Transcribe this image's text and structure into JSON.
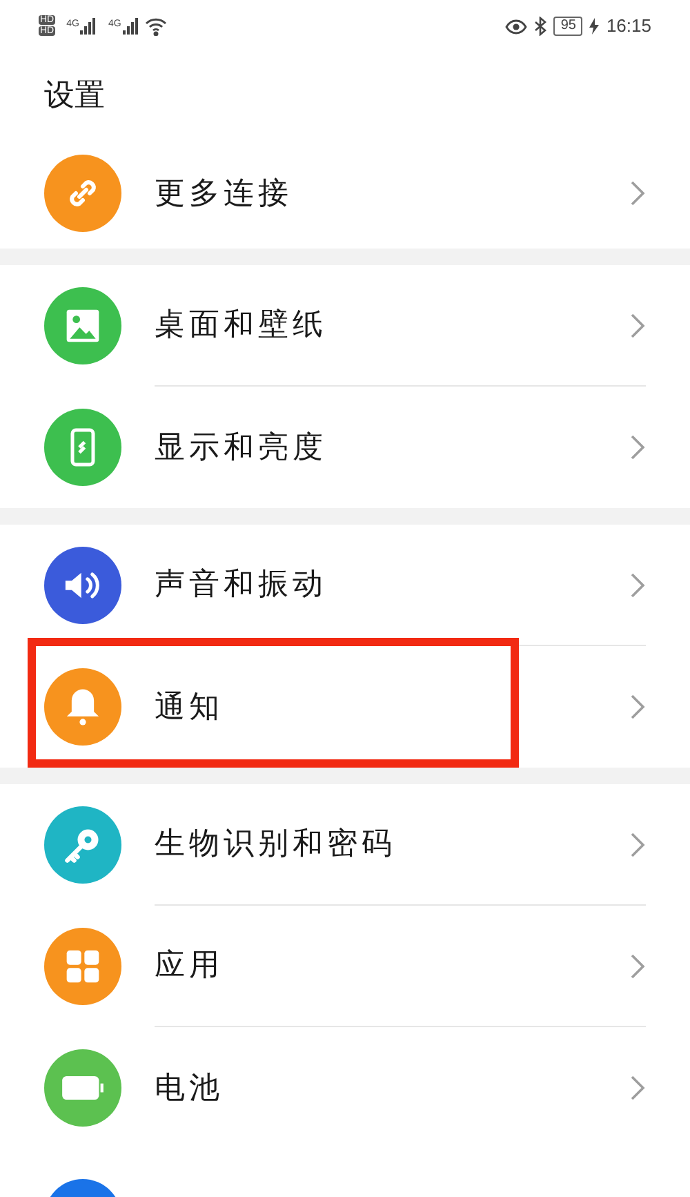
{
  "status_bar": {
    "sim_badges": [
      "HD",
      "HD"
    ],
    "networks": [
      "4G",
      "4G"
    ],
    "battery": "95",
    "time": "16:15"
  },
  "title": "设置",
  "groups": [
    {
      "items": [
        {
          "label": "更多连接",
          "kind": "link",
          "color": "#f7931e",
          "highlighted": false
        }
      ]
    },
    {
      "items": [
        {
          "label": "桌面和壁纸",
          "kind": "image",
          "color": "#3dbf4f",
          "highlighted": false
        },
        {
          "label": "显示和亮度",
          "kind": "phone",
          "color": "#3dbf4f",
          "highlighted": false
        }
      ]
    },
    {
      "items": [
        {
          "label": "声音和振动",
          "kind": "sound",
          "color": "#3b5bdb",
          "highlighted": false
        },
        {
          "label": "通知",
          "kind": "bell",
          "color": "#f7931e",
          "highlighted": true
        }
      ]
    },
    {
      "items": [
        {
          "label": "生物识别和密码",
          "kind": "key",
          "color": "#1fb5c4",
          "highlighted": false
        },
        {
          "label": "应用",
          "kind": "apps",
          "color": "#f7931e",
          "highlighted": false
        },
        {
          "label": "电池",
          "kind": "battery",
          "color": "#5cc150",
          "highlighted": false
        },
        {
          "kind": "partial",
          "color": "#1a73e8",
          "highlighted": false
        }
      ]
    }
  ]
}
